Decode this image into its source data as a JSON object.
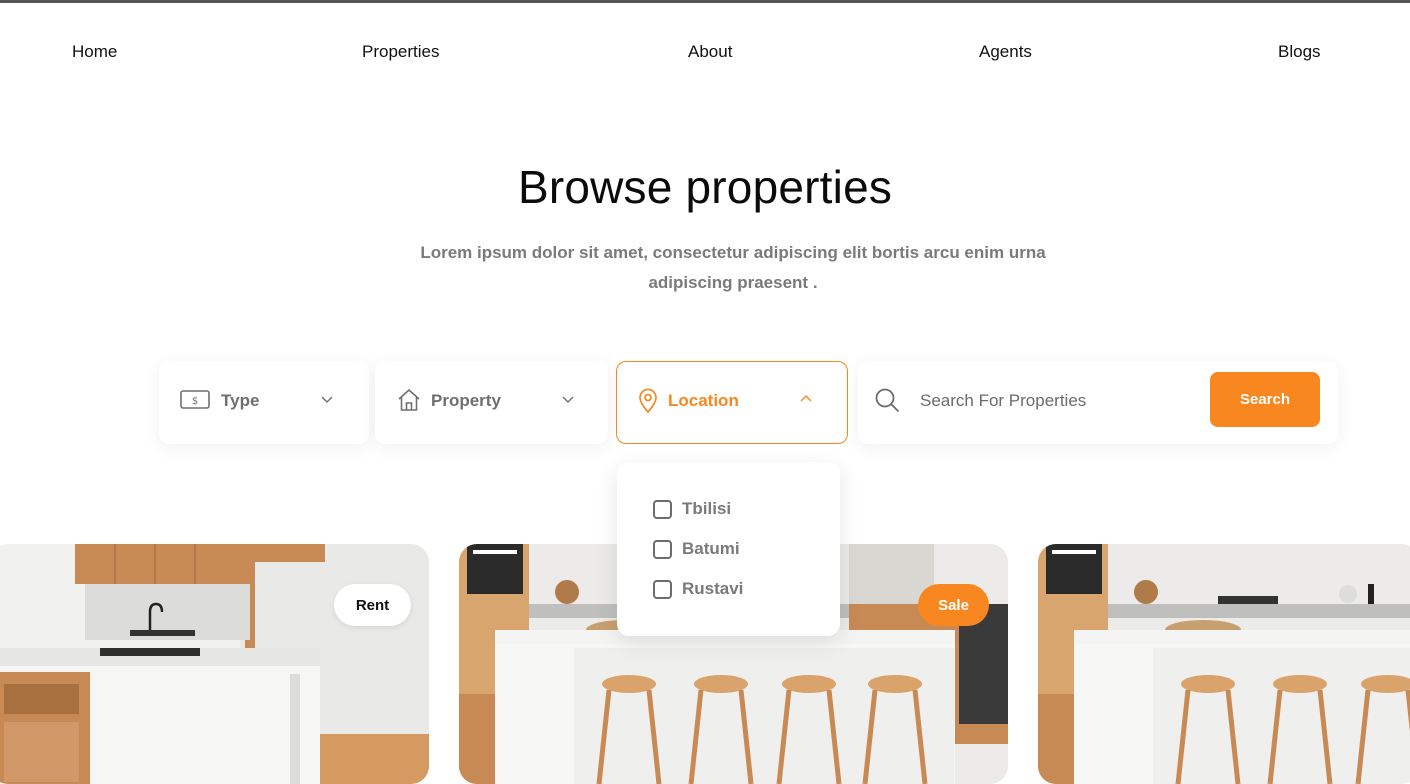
{
  "nav": {
    "items": [
      {
        "label": "Home"
      },
      {
        "label": "Properties"
      },
      {
        "label": "About"
      },
      {
        "label": "Agents"
      },
      {
        "label": "Blogs"
      }
    ]
  },
  "hero": {
    "title": "Browse properties",
    "subtitle": "Lorem ipsum dolor sit amet, consectetur adipiscing elit bortis arcu enim urna adipiscing praesent ."
  },
  "filters": {
    "type_label": "Type",
    "property_label": "Property",
    "location_label": "Location",
    "search_placeholder": "Search For Properties",
    "search_button": "Search"
  },
  "location_dropdown": {
    "options": [
      {
        "label": "Tbilisi",
        "checked": false
      },
      {
        "label": "Batumi",
        "checked": false
      },
      {
        "label": "Rustavi",
        "checked": false
      }
    ]
  },
  "cards": [
    {
      "badge": "Rent"
    },
    {
      "badge": "Sale"
    },
    {
      "badge": ""
    }
  ],
  "colors": {
    "accent": "#f7871e",
    "text": "#111111",
    "muted": "#7a7a7a"
  },
  "icons": [
    "dollar-bill-icon",
    "house-icon",
    "location-pin-icon",
    "search-icon",
    "chevron-down-icon",
    "chevron-up-icon"
  ]
}
